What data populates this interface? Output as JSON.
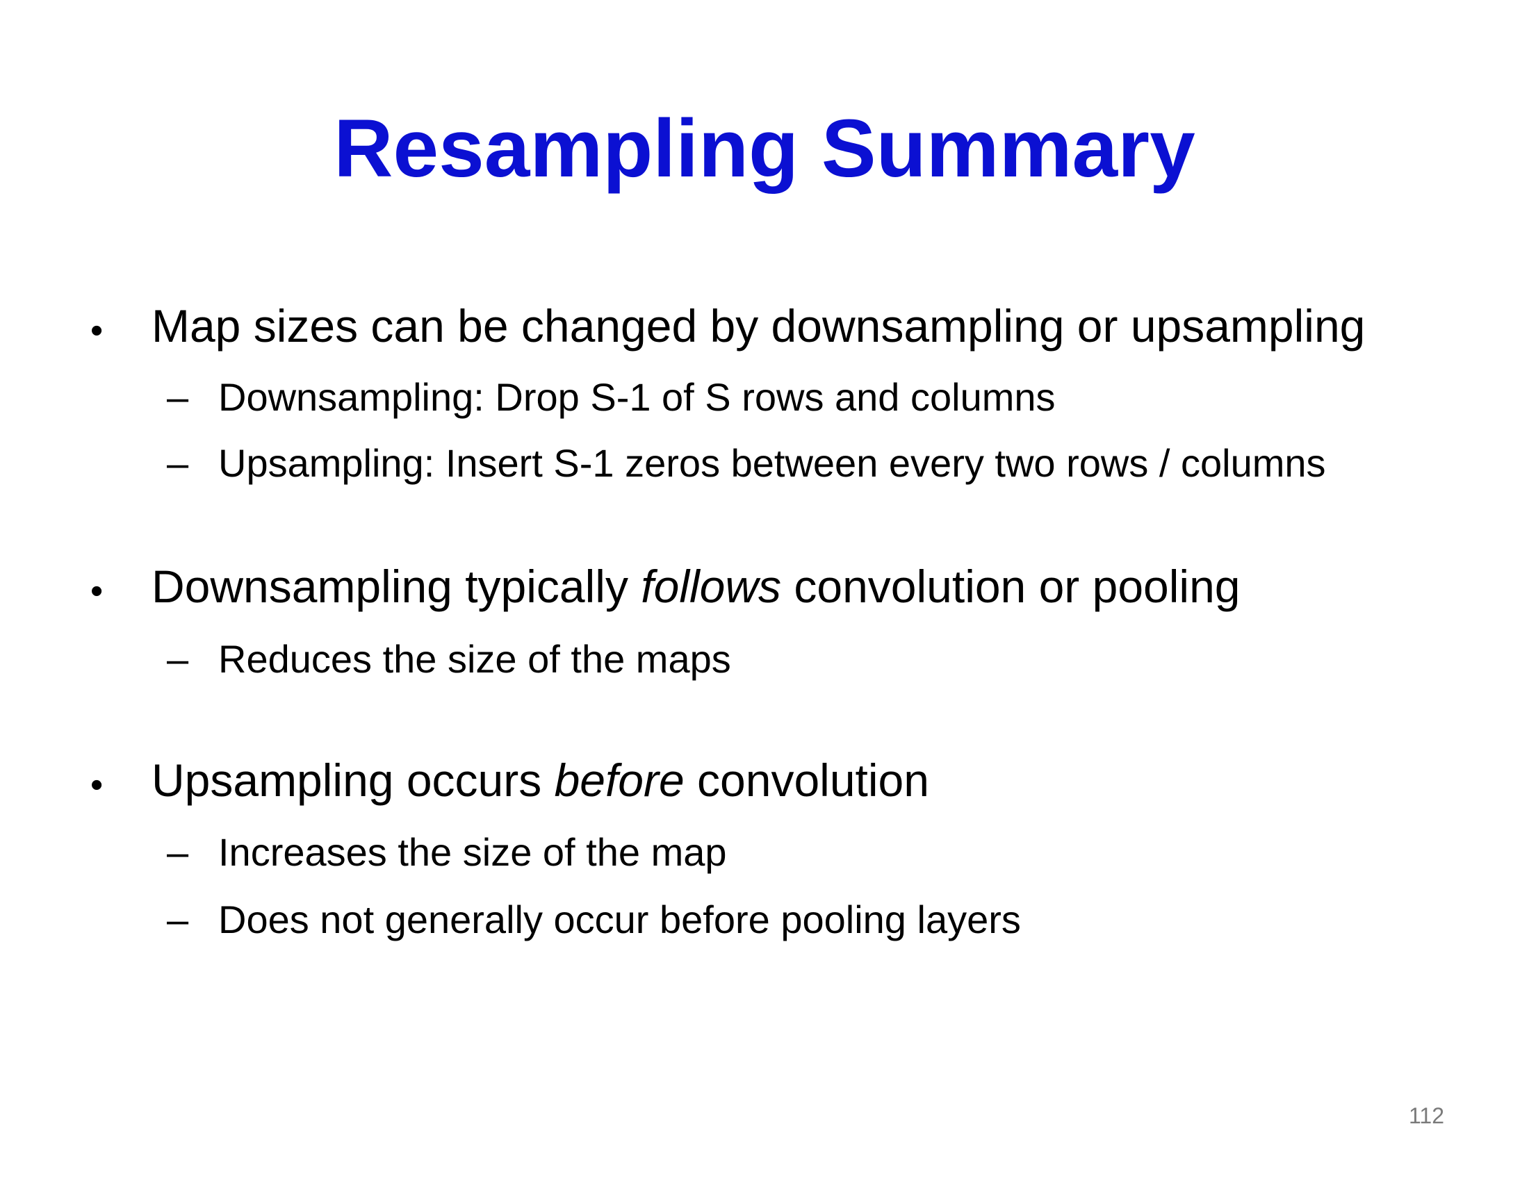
{
  "slide": {
    "title": "Resampling Summary",
    "page_number": "112",
    "bullets": [
      {
        "marker": "•",
        "text_before": "Map sizes can be changed by downsampling or upsampling",
        "emphasis": "",
        "text_after": "",
        "subitems": [
          {
            "marker": "–",
            "text": "Downsampling:  Drop S-1 of S rows and columns"
          },
          {
            "marker": "–",
            "text": "Upsampling: Insert S-1 zeros between every two rows / columns"
          }
        ]
      },
      {
        "marker": "•",
        "text_before": "Downsampling typically ",
        "emphasis": "follows",
        "text_after": " convolution or pooling",
        "subitems": [
          {
            "marker": "–",
            "text": "Reduces the size of the maps"
          }
        ]
      },
      {
        "marker": "•",
        "text_before": "Upsampling occurs ",
        "emphasis": "before",
        "text_after": " convolution",
        "subitems": [
          {
            "marker": "–",
            "text": "Increases the size of the map"
          },
          {
            "marker": "–",
            "text": "Does not generally occur before pooling layers"
          }
        ]
      }
    ],
    "colors": {
      "title": "#0b10d2",
      "body_text": "#000000",
      "page_number": "#7a7a7a",
      "background": "#ffffff"
    }
  }
}
